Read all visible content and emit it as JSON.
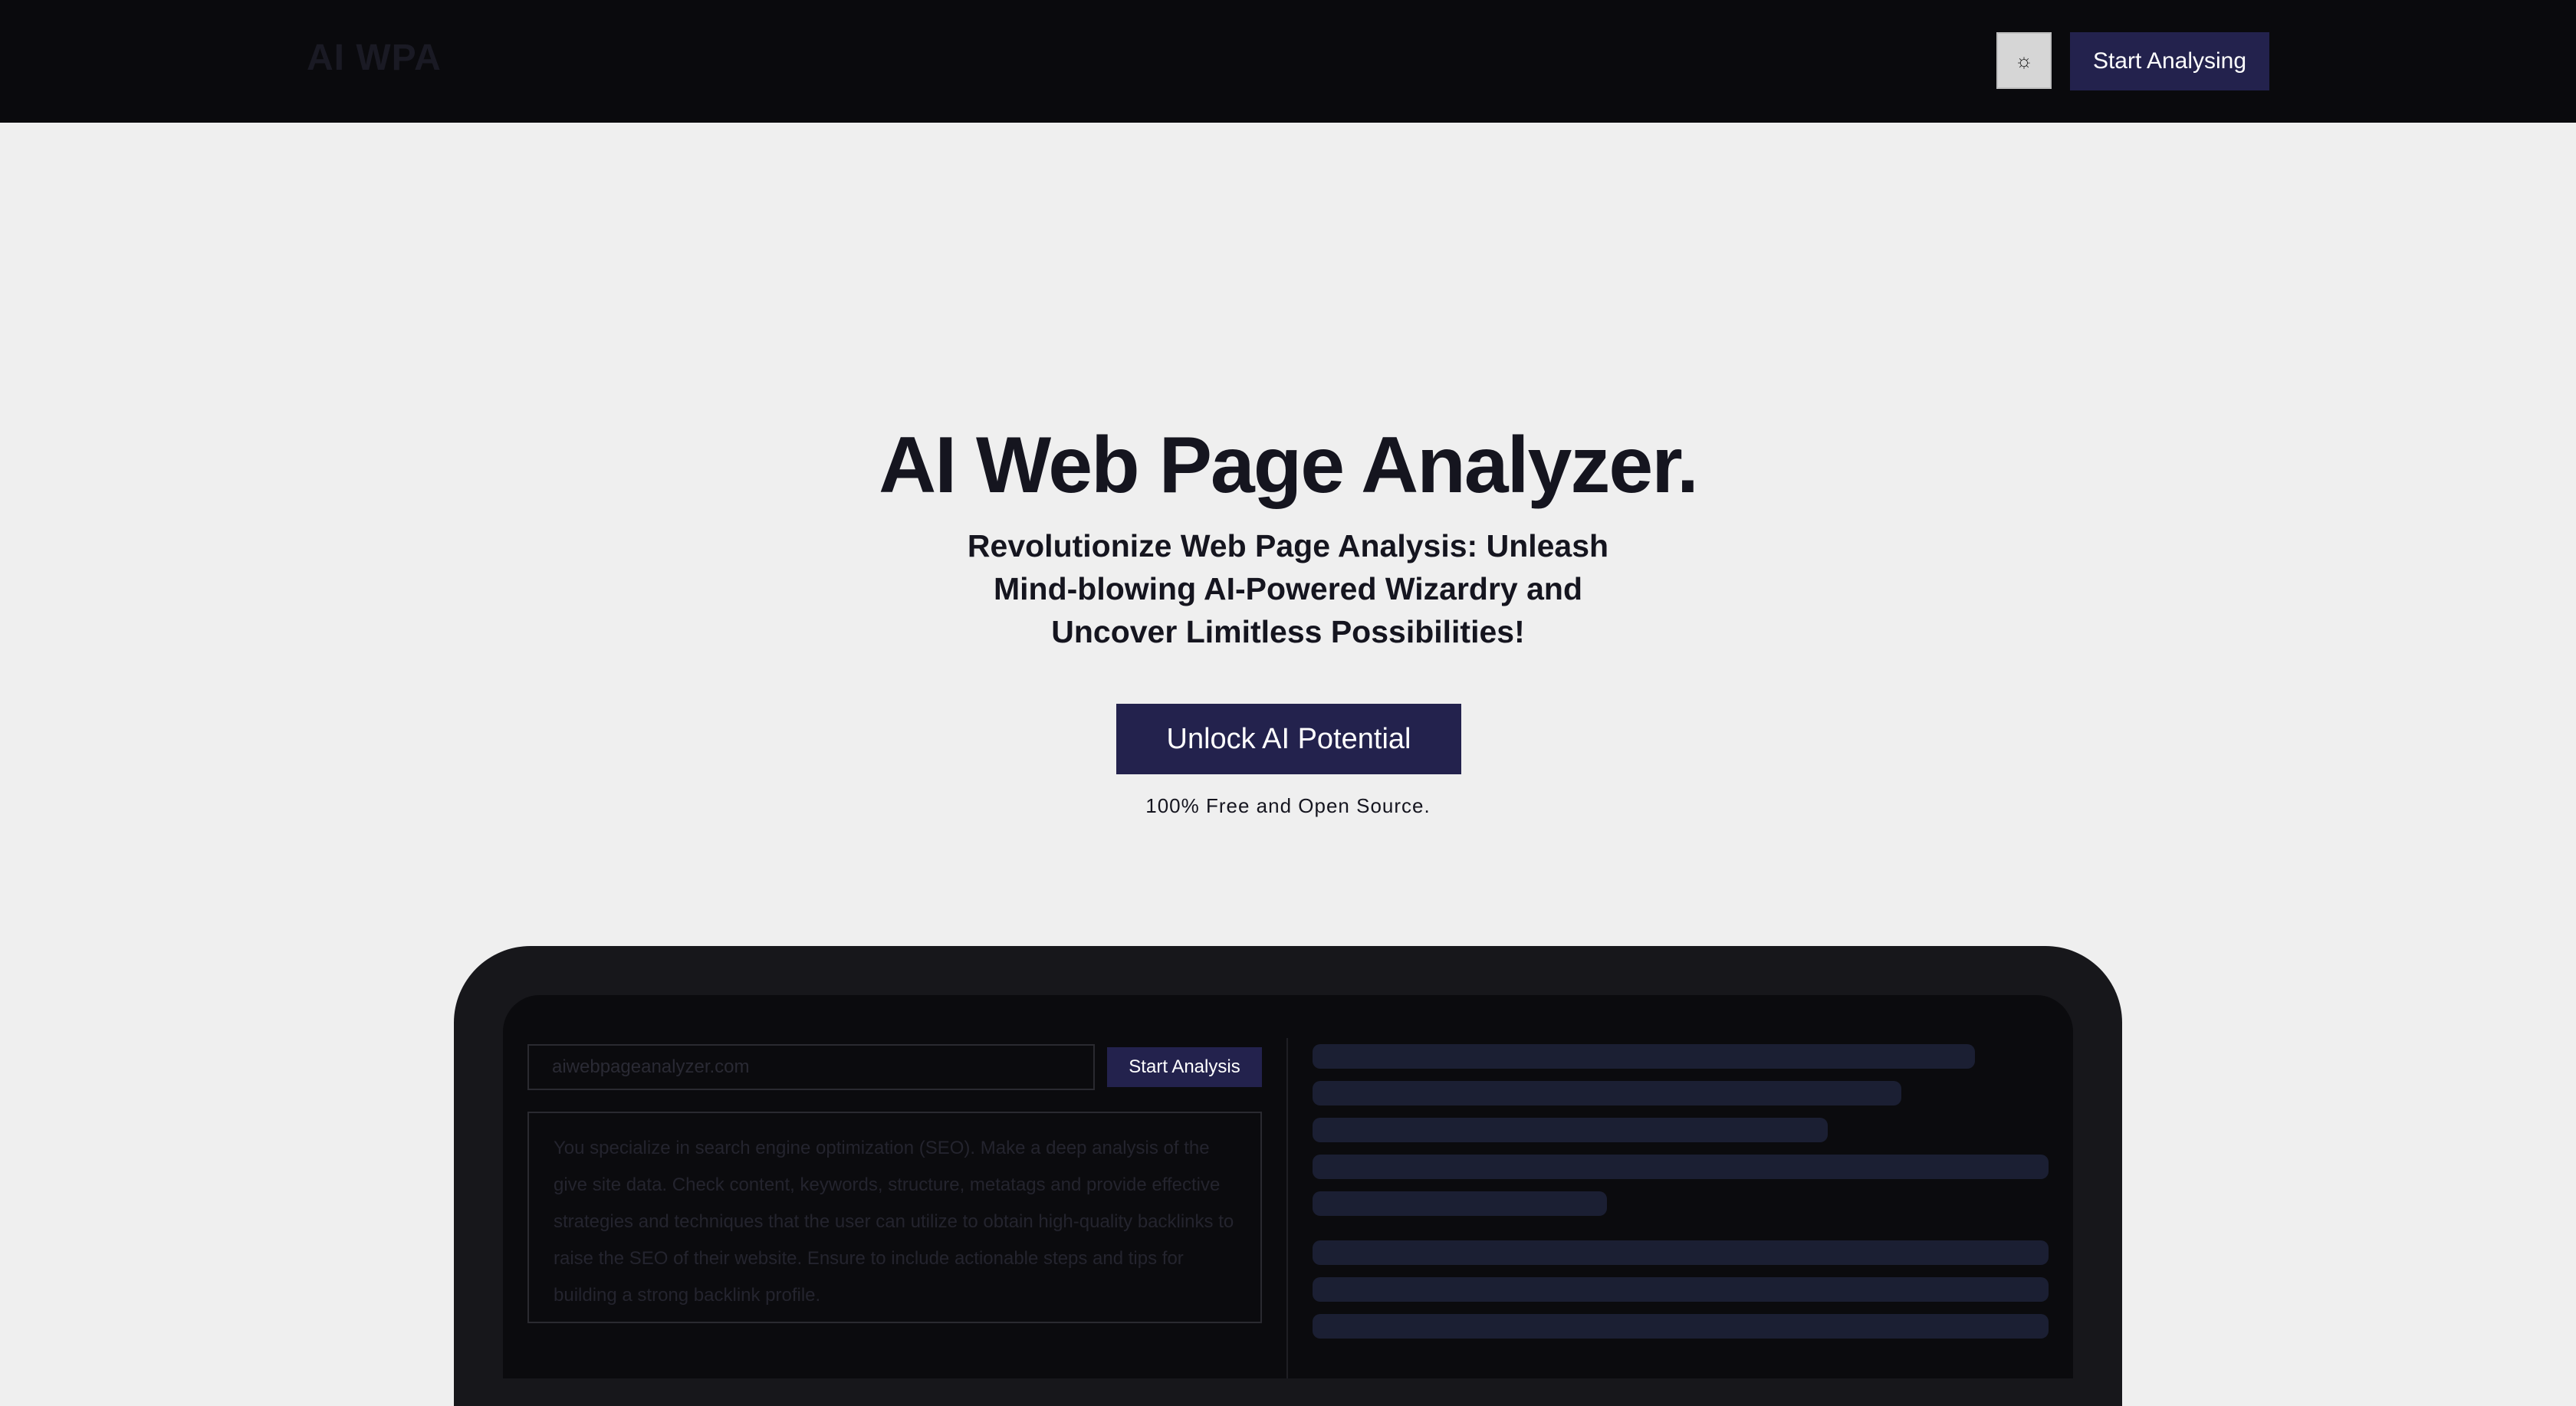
{
  "nav": {
    "logo": "AI WPA",
    "theme_icon": "sun-icon",
    "cta_label": "Start Analysing"
  },
  "hero": {
    "title": "AI Web Page Analyzer.",
    "subtitle": "Revolutionize Web Page Analysis: Unleash Mind-blowing AI-Powered Wizardry and Uncover Limitless Possibilities!",
    "cta_label": "Unlock AI Potential",
    "note": "100% Free and Open Source."
  },
  "preview": {
    "url_placeholder": "aiwebpageanalyzer.com",
    "analyze_label": "Start Analysis",
    "prompt_text": "You specialize in search engine optimization (SEO). Make a deep analysis of the give site data. Check content, keywords, structure, metatags and provide effective strategies and techniques that the user can utilize to obtain high-quality backlinks to raise the SEO of their website. Ensure to include actionable steps and tips for building a strong backlink profile."
  },
  "colors": {
    "accent": "#23224d",
    "navbar_bg": "#0a0a0d",
    "page_bg": "#efefef",
    "device_frame": "#17171b",
    "screen_bg": "#0b0b0e",
    "skeleton": "#1b1f33"
  }
}
